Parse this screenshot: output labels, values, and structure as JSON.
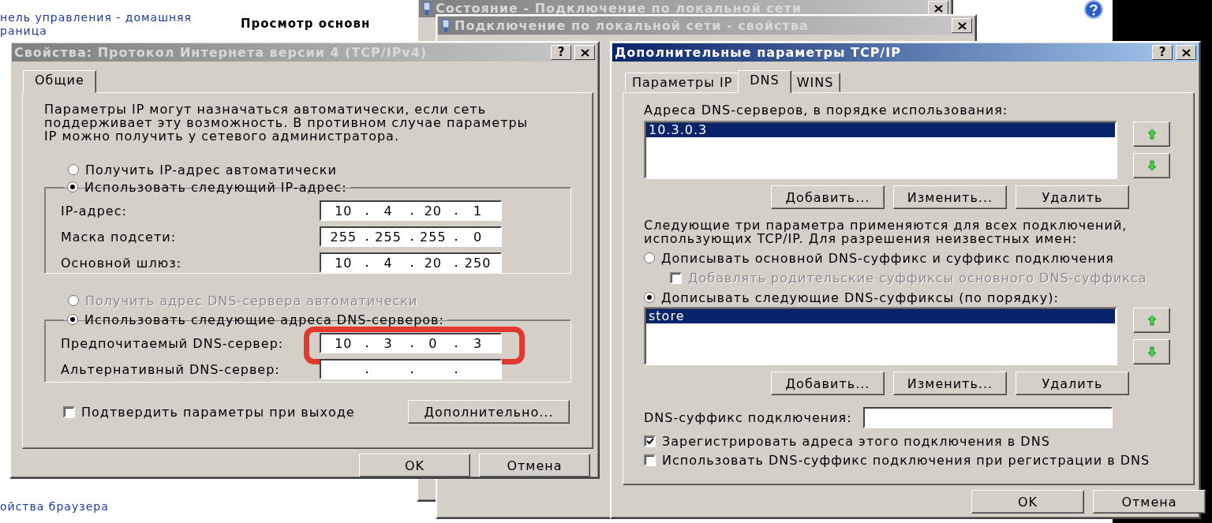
{
  "background_page": {
    "nav_link_lines": [
      "нель управления - домашняя",
      "раница"
    ],
    "heading": "Просмотр основн",
    "bottom_link": "ойства браузера"
  },
  "background_windows": [
    {
      "title": "Состояние - Подключение по локальной сети"
    },
    {
      "title": "Подключение по локальной сети - свойства"
    }
  ],
  "ipv4_dialog": {
    "title": "Свойства: Протокол Интернета версии 4 (TCP/IPv4)",
    "active": false,
    "help_button": "?",
    "tabs": [
      {
        "label": "Общие",
        "selected": true
      }
    ],
    "description": "Параметры IP могут назначаться автоматически, если сеть поддерживает эту возможность. В противном случае параметры IP можно получить у сетевого администратора.",
    "ip_mode": [
      {
        "label": "Получить IP-адрес автоматически",
        "selected": false,
        "disabled": false
      },
      {
        "label": "Использовать следующий IP-адрес:",
        "selected": true,
        "disabled": false
      }
    ],
    "ip_fields": [
      {
        "label": "IP-адрес:",
        "octets": [
          "10",
          "4",
          "20",
          "1"
        ]
      },
      {
        "label": "Маска подсети:",
        "octets": [
          "255",
          "255",
          "255",
          "0"
        ]
      },
      {
        "label": "Основной шлюз:",
        "octets": [
          "10",
          "4",
          "20",
          "250"
        ]
      }
    ],
    "dns_mode": [
      {
        "label": "Получить адрес DNS-сервера автоматически",
        "selected": false,
        "disabled": true
      },
      {
        "label": "Использовать следующие адреса DNS-серверов:",
        "selected": true,
        "disabled": false
      }
    ],
    "dns_fields": [
      {
        "label": "Предпочитаемый DNS-сервер:",
        "octets": [
          "10",
          "3",
          "0",
          "3"
        ],
        "highlighted": true
      },
      {
        "label": "Альтернативный DNS-сервер:"
      }
    ],
    "confirm_checkbox": {
      "label": "Подтвердить параметры при выходе",
      "checked": false
    },
    "advanced_button": "Дополнительно...",
    "ok_button": "OK",
    "cancel_button": "Отмена"
  },
  "advanced_dialog": {
    "title": "Дополнительные параметры TCP/IP",
    "active": true,
    "help_button": "?",
    "tabs": [
      {
        "label": "Параметры IP",
        "selected": false
      },
      {
        "label": "DNS",
        "selected": true
      },
      {
        "label": "WINS",
        "selected": false
      }
    ],
    "dns_servers": {
      "label": "Адреса DNS-серверов, в порядке использования:",
      "items": [
        {
          "text": "10.3.0.3",
          "selected": true
        }
      ],
      "buttons": [
        "Добавить...",
        "Изменить...",
        "Удалить"
      ]
    },
    "note": "Следующие три параметра применяются для всех подключений, использующих TCP/IP. Для разрешения неизвестных имен:",
    "suffix_options": [
      {
        "kind": "radio",
        "label": "Дописывать основной DNS-суффикс и суффикс подключения",
        "selected": false,
        "disabled": false
      },
      {
        "kind": "checkbox",
        "label": "Добавлять родительские суффиксы основного DNS-суффикса",
        "checked": false,
        "disabled": true
      },
      {
        "kind": "radio",
        "label": "Дописывать следующие DNS-суффиксы (по порядку):",
        "selected": true,
        "disabled": false
      }
    ],
    "suffix_list": {
      "items": [
        {
          "text": "store",
          "selected": true
        }
      ],
      "buttons": [
        "Добавить...",
        "Изменить...",
        "Удалить"
      ]
    },
    "connection_suffix": {
      "label": "DNS-суффикс подключения:"
    },
    "checkboxes": [
      {
        "label": "Зарегистрировать адреса этого подключения в DNS",
        "checked": true
      },
      {
        "label": "Использовать DNS-суффикс подключения при регистрации в DNS",
        "checked": false
      }
    ],
    "ok_button": "OK",
    "cancel_button": "Отмена"
  }
}
